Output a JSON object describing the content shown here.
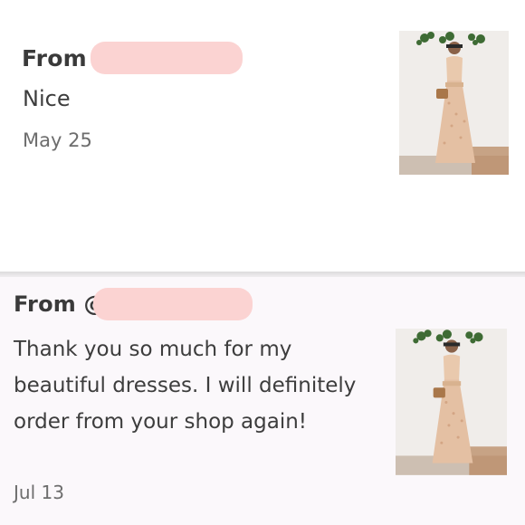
{
  "reviews": [
    {
      "from_label": "From",
      "message": "Nice",
      "date": "May 25"
    },
    {
      "from_label": "From @",
      "message": "Thank you so much for my beautiful dresses. I will definitely order from your shop again!",
      "date": "Jul 13"
    }
  ],
  "colors": {
    "redaction": "#fbd3d2",
    "dress": "#e9c9ad",
    "handbag": "#a9774a",
    "background_card": "#fbf8fb"
  },
  "icons": {
    "product_thumbnail": "dress-photo-icon"
  }
}
